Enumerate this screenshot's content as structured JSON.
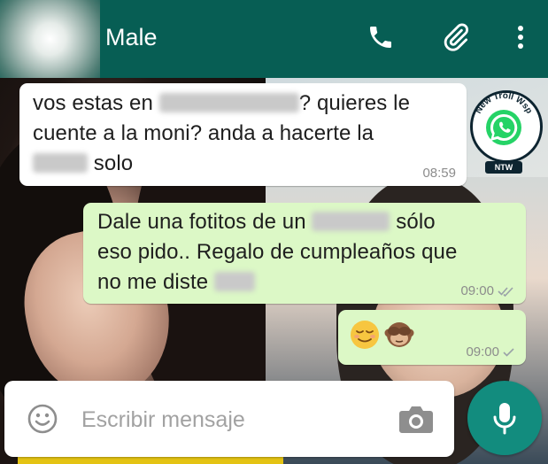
{
  "header": {
    "contact_name": "Male",
    "icons": [
      "call-icon",
      "attach-icon",
      "more-icon"
    ]
  },
  "messages": [
    {
      "direction": "incoming",
      "lines": [
        "vos estas en",
        "? quieres le",
        "cuente a la moni? anda a hacerte la",
        "solo"
      ],
      "time": "08:59"
    },
    {
      "direction": "outgoing",
      "lines": [
        "Dale una fotitos de un",
        "sólo",
        "eso pido.. Regalo de cumpleaños que",
        "no me diste"
      ],
      "time": "09:00",
      "status": "read"
    },
    {
      "direction": "outgoing",
      "emojis": [
        "relieved-face",
        "see-no-evil-monkey"
      ],
      "time": "09:00",
      "status": "sent"
    }
  ],
  "badge": {
    "text": "New Troll Wsp",
    "short": "NTW"
  },
  "composer": {
    "placeholder": "Escribir mensaje"
  },
  "colors": {
    "header": "#075e54",
    "outgoing": "#dcf8c6",
    "incoming": "#ffffff",
    "fab": "#128c7e"
  }
}
